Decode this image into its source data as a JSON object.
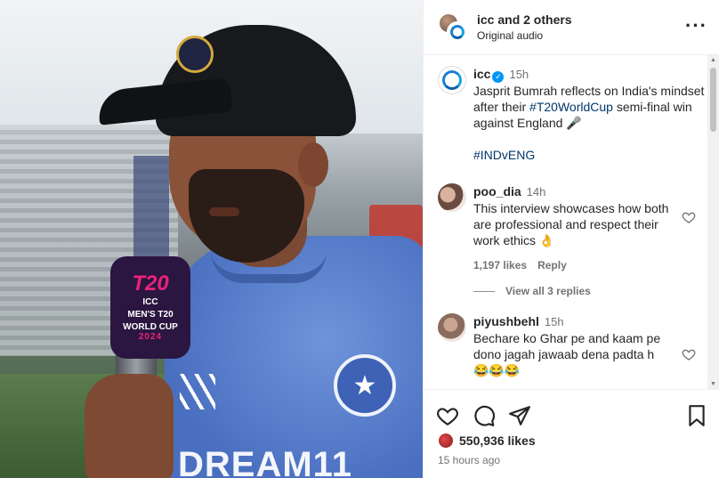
{
  "post": {
    "sponsor_text": "DREAM11",
    "mic": {
      "brand": "T20",
      "line1": "ICC",
      "line2": "MEN'S T20",
      "line3": "WORLD CUP",
      "year": "2024"
    }
  },
  "header": {
    "users": "icc and 2 others",
    "audio": "Original audio",
    "more_icon": "more-horizontal-icon"
  },
  "caption": {
    "username": "icc",
    "time": "15h",
    "text": "Jasprit Bumrah reflects on India's mindset after their",
    "hashtag1": "#T20WorldCup",
    "text2": "semi-final win against England 🎤",
    "hashtag2": "#INDvENG"
  },
  "comments": [
    {
      "username": "poo_dia",
      "time": "14h",
      "text": "This interview showcases how both are professional and respect their work ethics 👌",
      "likes": "1,197 likes",
      "reply": "Reply",
      "view_replies": "View all 3 replies"
    },
    {
      "username": "piyushbehl",
      "time": "15h",
      "text": "Bechare ko Ghar pe and kaam pe dono jagah jawaab dena padta h",
      "emoji": "😂😂😂"
    }
  ],
  "footer": {
    "likes": "550,936 likes",
    "ago": "15 hours ago"
  },
  "colors": {
    "link": "#00376b",
    "verified": "#0095f6",
    "muted": "#737373"
  }
}
